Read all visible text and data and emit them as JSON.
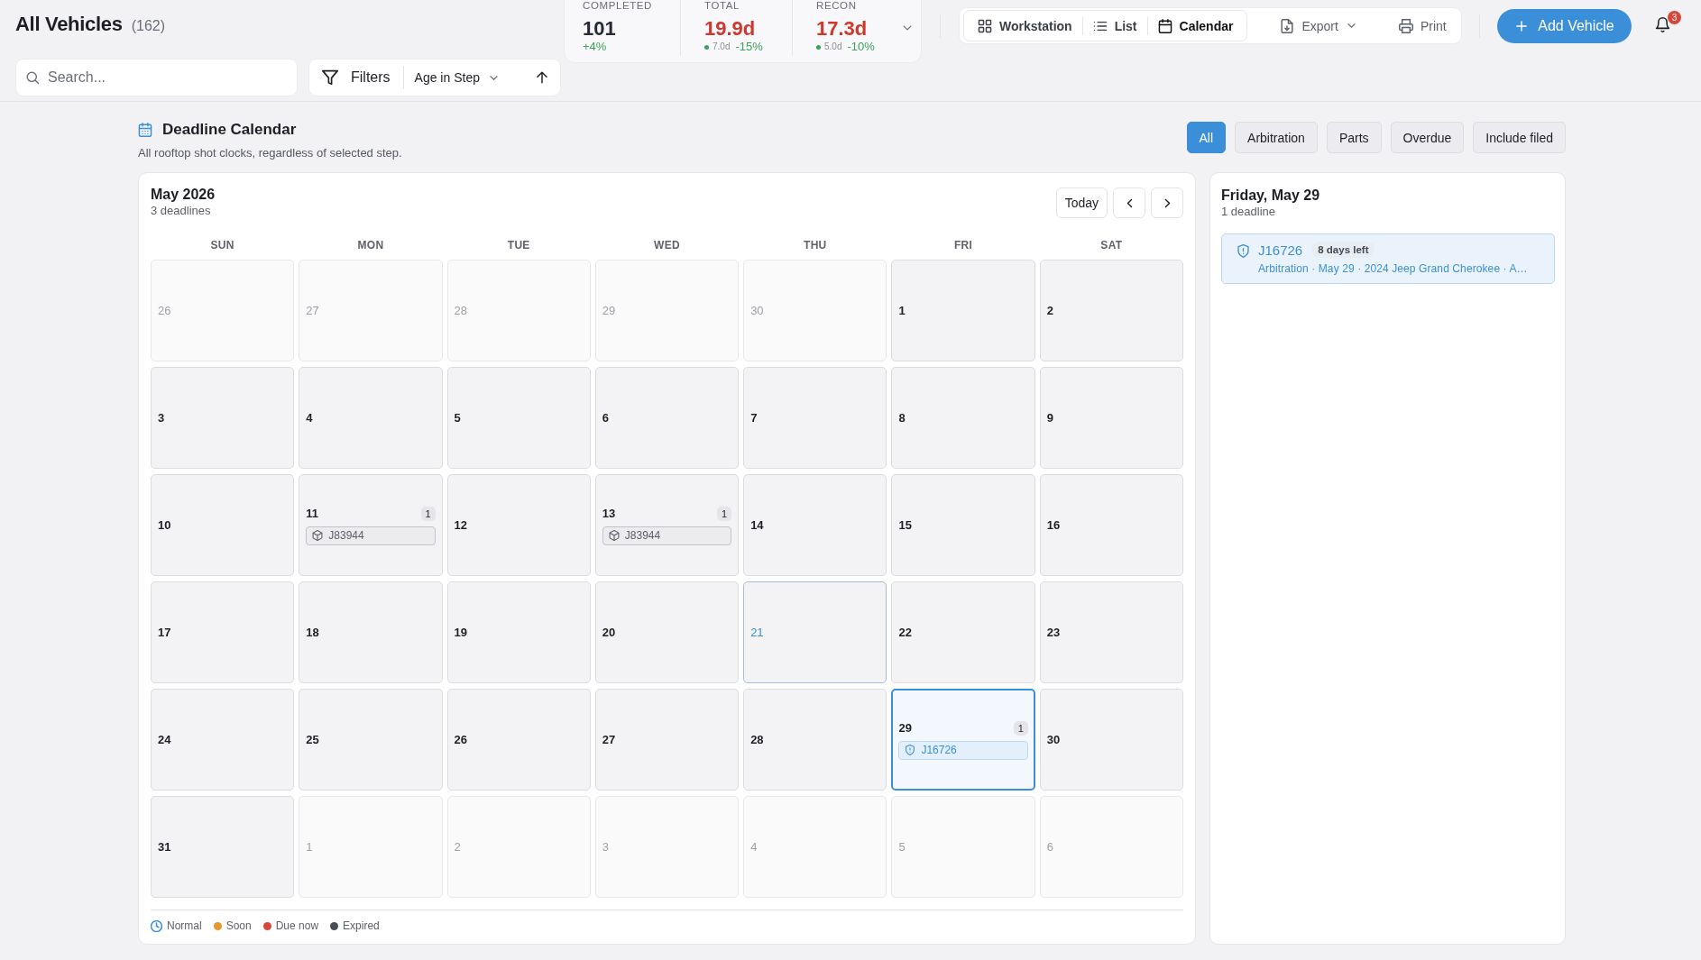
{
  "header": {
    "title": "All Vehicles",
    "count": "(162)",
    "search": {
      "placeholder": "Search..."
    },
    "filters": {
      "label": "Filters",
      "sort": "Age in Step"
    }
  },
  "stats": [
    {
      "label": "COMPLETED",
      "value": "101",
      "color": "#262a36",
      "delta": "+4%"
    },
    {
      "label": "TOTAL",
      "value": "19.9d",
      "color": "#d0362c",
      "baseline": "7.0d",
      "delta": "-15%"
    },
    {
      "label": "RECON",
      "value": "17.3d",
      "color": "#d0362c",
      "baseline": "5.0d",
      "delta": "-10%"
    }
  ],
  "views": [
    {
      "label": "Workstation",
      "kind": "grid",
      "selected": false
    },
    {
      "label": "List",
      "kind": "list",
      "selected": false
    },
    {
      "label": "Calendar",
      "kind": "calendar",
      "selected": true
    }
  ],
  "actions": [
    {
      "label": "Export",
      "kind": "export"
    },
    {
      "label": "Print",
      "kind": "print"
    }
  ],
  "add_button": "Add Vehicle",
  "notifications": {
    "count": "3"
  },
  "section": {
    "title": "Deadline Calendar",
    "subtitle": "All rooftop shot clocks, regardless of selected step."
  },
  "type_filters": [
    {
      "label": "All",
      "selected": true
    },
    {
      "label": "Arbitration",
      "selected": false
    },
    {
      "label": "Parts",
      "selected": false
    },
    {
      "label": "Overdue",
      "selected": false
    },
    {
      "label": "Include filed",
      "selected": false
    }
  ],
  "calendar": {
    "month": "May 2026",
    "count": "3 deadlines",
    "today_button": "Today",
    "weekdays": [
      "SUN",
      "MON",
      "TUE",
      "WED",
      "THU",
      "FRI",
      "SAT"
    ],
    "weeks": [
      [
        {
          "day": "26",
          "in_month": false,
          "today": false,
          "selected": false
        },
        {
          "day": "27",
          "in_month": false,
          "today": false,
          "selected": false
        },
        {
          "day": "28",
          "in_month": false,
          "today": false,
          "selected": false
        },
        {
          "day": "29",
          "in_month": false,
          "today": false,
          "selected": false
        },
        {
          "day": "30",
          "in_month": false,
          "today": false,
          "selected": false
        },
        {
          "day": "1",
          "in_month": true,
          "today": false,
          "selected": false
        },
        {
          "day": "2",
          "in_month": true,
          "today": false,
          "selected": false
        }
      ],
      [
        {
          "day": "3",
          "in_month": true,
          "today": false,
          "selected": false
        },
        {
          "day": "4",
          "in_month": true,
          "today": false,
          "selected": false
        },
        {
          "day": "5",
          "in_month": true,
          "today": false,
          "selected": false
        },
        {
          "day": "6",
          "in_month": true,
          "today": false,
          "selected": false
        },
        {
          "day": "7",
          "in_month": true,
          "today": false,
          "selected": false
        },
        {
          "day": "8",
          "in_month": true,
          "today": false,
          "selected": false
        },
        {
          "day": "9",
          "in_month": true,
          "today": false,
          "selected": false
        }
      ],
      [
        {
          "day": "10",
          "in_month": true,
          "today": false,
          "selected": false
        },
        {
          "day": "11",
          "in_month": true,
          "today": false,
          "selected": false,
          "count": "1",
          "events": [
            {
              "vehicle": "J83944",
              "kind": "parts"
            }
          ]
        },
        {
          "day": "12",
          "in_month": true,
          "today": false,
          "selected": false
        },
        {
          "day": "13",
          "in_month": true,
          "today": false,
          "selected": false,
          "count": "1",
          "events": [
            {
              "vehicle": "J83944",
              "kind": "parts"
            }
          ]
        },
        {
          "day": "14",
          "in_month": true,
          "today": false,
          "selected": false
        },
        {
          "day": "15",
          "in_month": true,
          "today": false,
          "selected": false
        },
        {
          "day": "16",
          "in_month": true,
          "today": false,
          "selected": false
        }
      ],
      [
        {
          "day": "17",
          "in_month": true,
          "today": false,
          "selected": false
        },
        {
          "day": "18",
          "in_month": true,
          "today": false,
          "selected": false
        },
        {
          "day": "19",
          "in_month": true,
          "today": false,
          "selected": false
        },
        {
          "day": "20",
          "in_month": true,
          "today": false,
          "selected": false
        },
        {
          "day": "21",
          "in_month": true,
          "today": true,
          "selected": false
        },
        {
          "day": "22",
          "in_month": true,
          "today": false,
          "selected": false
        },
        {
          "day": "23",
          "in_month": true,
          "today": false,
          "selected": false
        }
      ],
      [
        {
          "day": "24",
          "in_month": true,
          "today": false,
          "selected": false
        },
        {
          "day": "25",
          "in_month": true,
          "today": false,
          "selected": false
        },
        {
          "day": "26",
          "in_month": true,
          "today": false,
          "selected": false
        },
        {
          "day": "27",
          "in_month": true,
          "today": false,
          "selected": false
        },
        {
          "day": "28",
          "in_month": true,
          "today": false,
          "selected": false
        },
        {
          "day": "29",
          "in_month": true,
          "today": false,
          "selected": true,
          "count": "1",
          "events": [
            {
              "vehicle": "J16726",
              "kind": "arbitration"
            }
          ]
        },
        {
          "day": "30",
          "in_month": true,
          "today": false,
          "selected": false
        }
      ],
      [
        {
          "day": "31",
          "in_month": true,
          "today": false,
          "selected": false
        },
        {
          "day": "1",
          "in_month": false,
          "today": false,
          "selected": false
        },
        {
          "day": "2",
          "in_month": false,
          "today": false,
          "selected": false
        },
        {
          "day": "3",
          "in_month": false,
          "today": false,
          "selected": false
        },
        {
          "day": "4",
          "in_month": false,
          "today": false,
          "selected": false
        },
        {
          "day": "5",
          "in_month": false,
          "today": false,
          "selected": false
        },
        {
          "day": "6",
          "in_month": false,
          "today": false,
          "selected": false
        }
      ]
    ]
  },
  "legend": [
    {
      "label": "Normal",
      "kind": "clock",
      "color": "#3b8fd9"
    },
    {
      "label": "Soon",
      "kind": "dot",
      "color": "#e8972a"
    },
    {
      "label": "Due now",
      "kind": "dot",
      "color": "#d9453b"
    },
    {
      "label": "Expired",
      "kind": "dot",
      "color": "#4a4d57"
    }
  ],
  "day_panel": {
    "title": "Friday, May 29",
    "count": "1 deadline",
    "deadlines": [
      {
        "vehicle": "J16726",
        "kind": "arbitration",
        "remaining": "8 days left",
        "details": "Arbitration · May 29 · 2024 Jeep Grand Cherokee · A…"
      }
    ]
  }
}
